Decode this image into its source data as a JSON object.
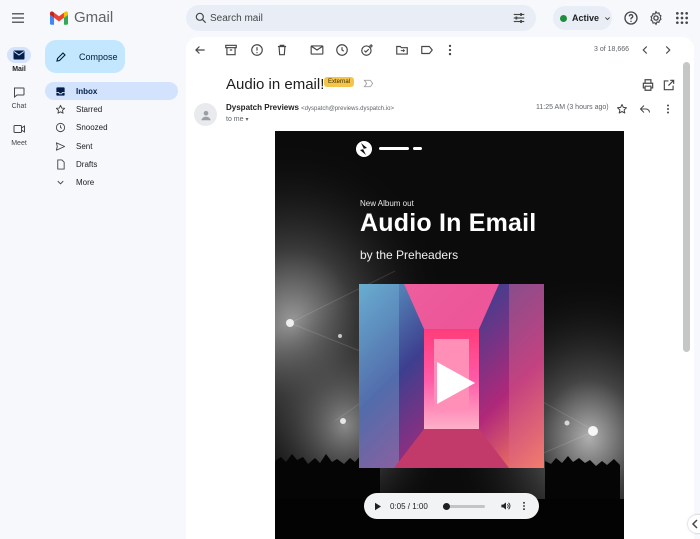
{
  "app": {
    "name": "Gmail"
  },
  "search": {
    "placeholder": "Search mail"
  },
  "status": {
    "label": "Active",
    "color": "#1e8e3e"
  },
  "rail": [
    {
      "label": "Mail",
      "icon": "mail-icon"
    },
    {
      "label": "Chat",
      "icon": "chat-icon"
    },
    {
      "label": "Meet",
      "icon": "video-icon"
    }
  ],
  "sidebar": {
    "compose_label": "Compose",
    "items": [
      {
        "label": "Inbox",
        "icon": "inbox-icon",
        "active": true
      },
      {
        "label": "Starred",
        "icon": "star-icon"
      },
      {
        "label": "Snoozed",
        "icon": "clock-icon"
      },
      {
        "label": "Sent",
        "icon": "send-icon"
      },
      {
        "label": "Drafts",
        "icon": "draft-icon"
      },
      {
        "label": "More",
        "icon": "chevron-down-icon"
      }
    ]
  },
  "toolbar": {
    "pager": "3 of 18,666"
  },
  "message": {
    "subject": "Audio in email!",
    "badge": "External",
    "sender_name": "Dyspatch Previews",
    "sender_email": "<dyspatch@previews.dyspatch.io>",
    "recipient": "to me",
    "time": "11:25 AM (3 hours ago)"
  },
  "email_body": {
    "tagline": "New Album out",
    "title": "Audio In Email",
    "subtitle": "by the Preheaders",
    "audio": {
      "time": "0:05 / 1:00",
      "progress": 0.083
    }
  },
  "colors": {
    "accent": "#0b57d0",
    "compose_bg": "#c2e7ff",
    "active_nav": "#d3e3fd",
    "badge": "#f4c54a"
  }
}
